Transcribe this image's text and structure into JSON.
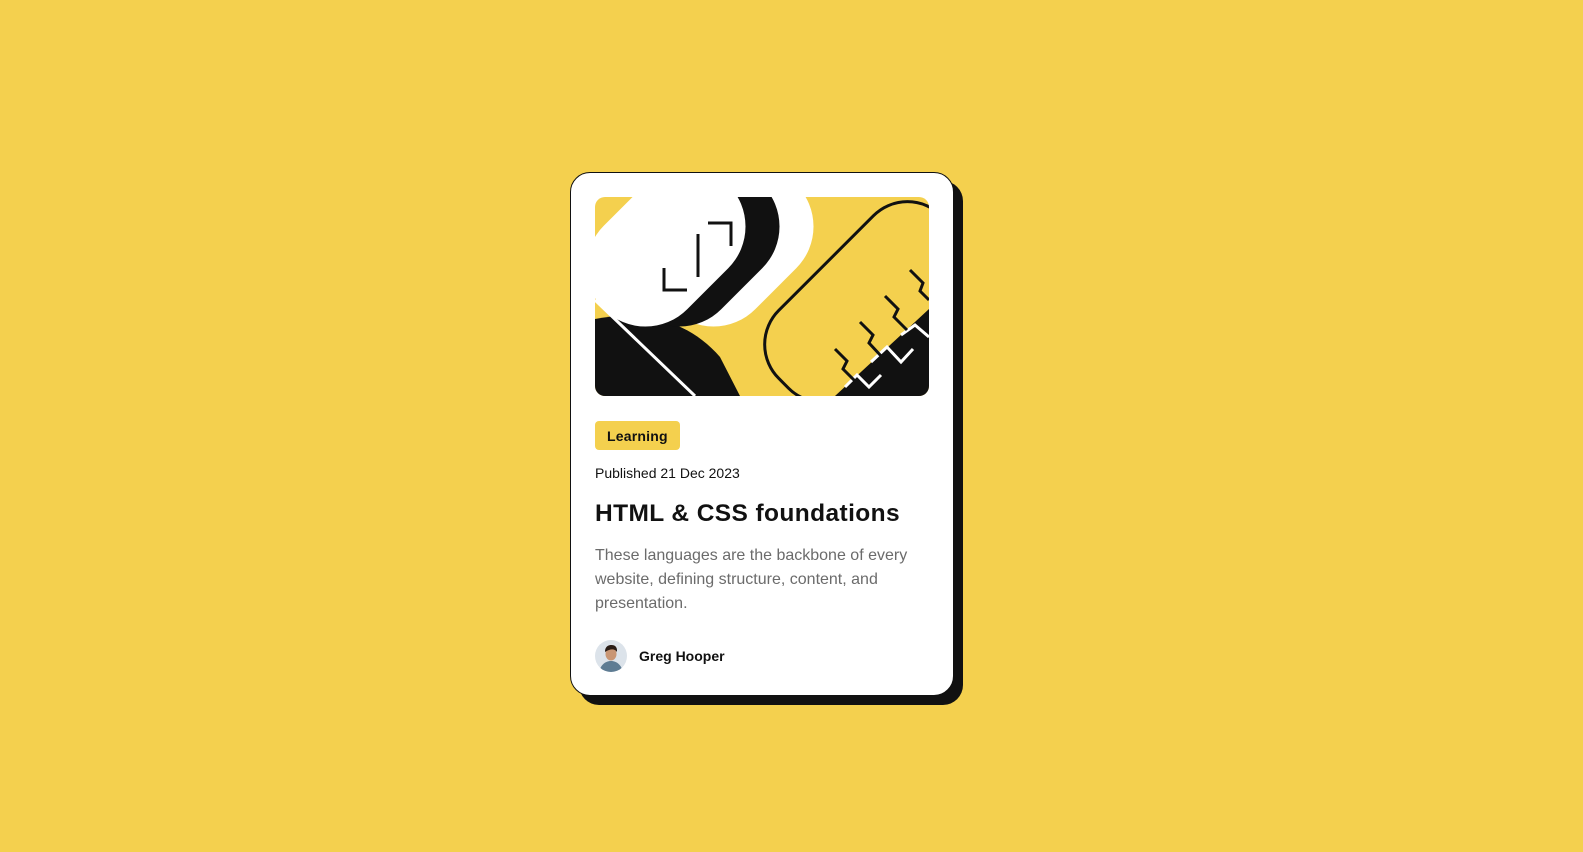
{
  "card": {
    "tag": "Learning",
    "published": "Published 21 Dec 2023",
    "title": "HTML & CSS foundations",
    "description": "These languages are the backbone of every website, defining structure, content, and presentation.",
    "author": {
      "name": "Greg Hooper"
    }
  },
  "colors": {
    "background": "#F4D04E",
    "card": "#FFFFFF",
    "ink": "#111111",
    "muted_text": "#6B6B6B"
  },
  "icons": {
    "hero": "abstract-illustration",
    "avatar": "person-avatar"
  }
}
